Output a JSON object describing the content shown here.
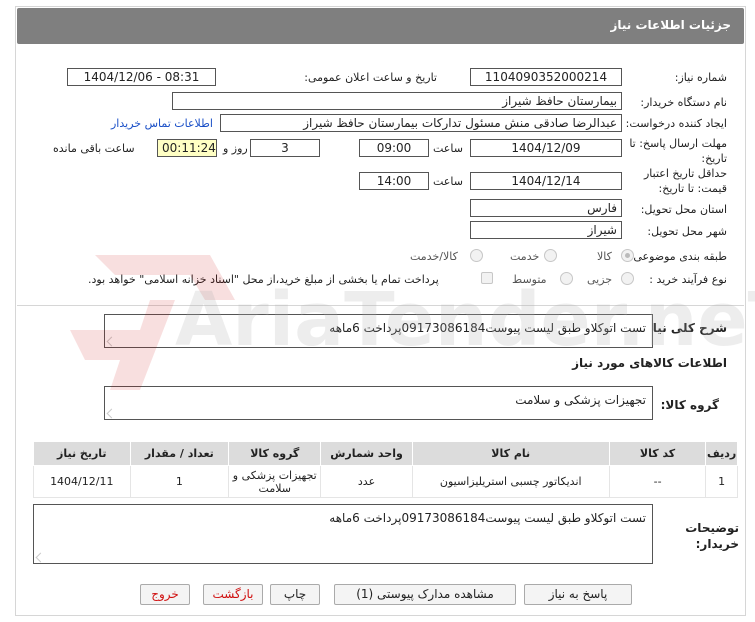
{
  "title": "جزئیات اطلاعات نیاز",
  "need_number": {
    "label": "شماره نیاز:",
    "value": "1104090352000214"
  },
  "announce": {
    "label": "تاریخ و ساعت اعلان عمومی:",
    "value": "1404/12/06 - 08:31"
  },
  "buyer": {
    "label": "نام دستگاه خریدار:",
    "value": "بیمارستان حافظ شیراز"
  },
  "creator": {
    "label": "ایجاد کننده درخواست:",
    "value": "عبدالرضا صادقی منش مسئول تداركات بيمارستان حافظ شيراز",
    "contact_link": "اطلاعات تماس خریدار"
  },
  "deadline": {
    "label": "مهلت ارسال پاسخ: تا تاریخ:",
    "date": "1404/12/09",
    "time_label": "ساعت",
    "time": "09:00",
    "days": "3",
    "days_label": "روز و",
    "remaining": "00:11:24",
    "remaining_label": "ساعت باقی مانده"
  },
  "validity": {
    "label_1": "حداقل تاریخ اعتبار",
    "label_2": "قیمت: تا تاریخ:",
    "date": "1404/12/14",
    "time_label": "ساعت",
    "time": "14:00"
  },
  "province": {
    "label": "استان محل تحویل:",
    "value": "فارس"
  },
  "city": {
    "label": "شهر محل تحویل:",
    "value": "شیراز"
  },
  "category": {
    "label": "طبقه بندی موضوعی:",
    "options": [
      "کالا",
      "خدمت",
      "کالا/خدمت"
    ]
  },
  "process": {
    "label": "نوع فرآیند خرید :",
    "options": [
      "جزیی",
      "متوسط"
    ],
    "payment_note": "پرداخت تمام یا بخشی از مبلغ خرید،از محل \"اسناد خزانه اسلامی\" خواهد بود."
  },
  "general_desc": {
    "label": "شرح کلی نیاز:",
    "value": "تست اتوکلاو طبق لیست پیوست09173086184پرداخت 6ماهه"
  },
  "goods_info_title": "اطلاعات کالاهای مورد نیاز",
  "goods_group": {
    "label": "گروه کالا:",
    "value": "تجهیزات پزشکی و سلامت"
  },
  "table": {
    "headers": [
      "ردیف",
      "کد کالا",
      "نام کالا",
      "واحد شمارش",
      "گروه کالا",
      "تعداد / مقدار",
      "تاریخ نیاز"
    ],
    "rows": [
      {
        "row": "1",
        "code": "--",
        "name": "اندیکاتور چسبی استریلیزاسیون",
        "unit": "عدد",
        "group": "تجهیزات پزشکی و سلامت",
        "qty": "1",
        "date": "1404/12/11"
      }
    ]
  },
  "buyer_notes": {
    "label_1": "توضیحات",
    "label_2": "خریدار:",
    "value": "تست اتوکلاو طبق لیست پیوست09173086184پرداخت 6ماهه"
  },
  "buttons": {
    "reply": "پاسخ به نیاز",
    "docs": "مشاهده مدارک پیوستی (1)",
    "print": "چاپ",
    "back": "بازگشت",
    "exit": "خروج"
  },
  "watermark": "AriaTender.neT",
  "colors": {
    "title_bar": "#7f7f7f",
    "link": "#1a4fc7",
    "yellow": "#ffffc4",
    "red_button_text": "#d01010"
  }
}
